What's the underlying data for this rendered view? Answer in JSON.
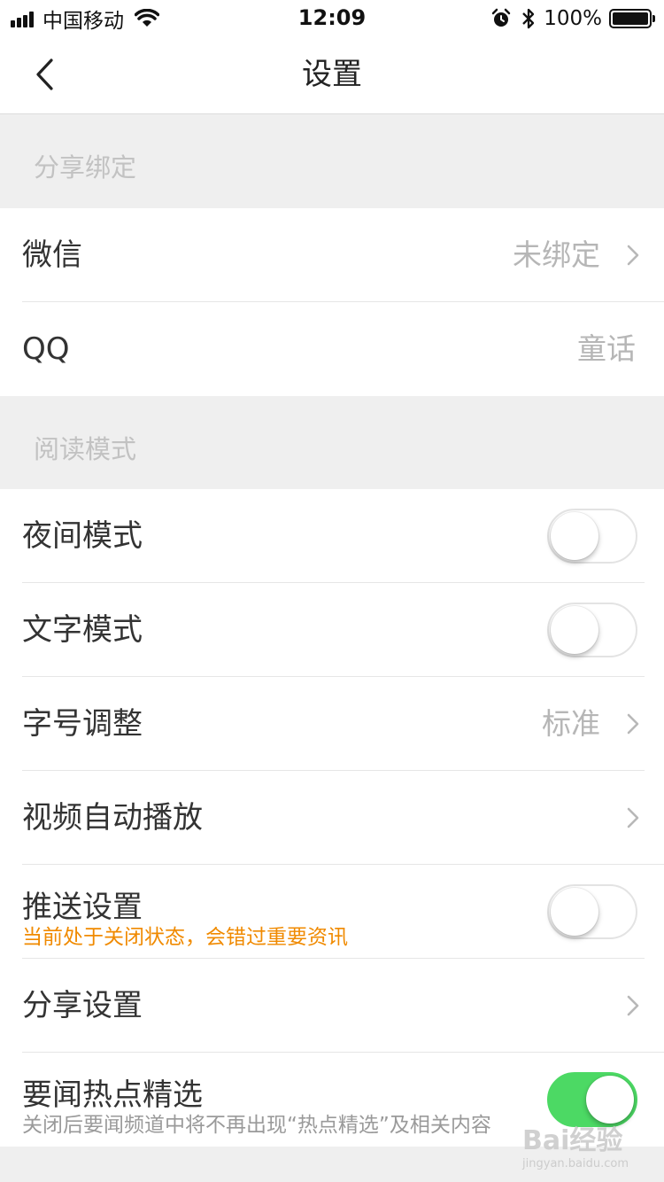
{
  "status_bar": {
    "carrier": "中国移动",
    "time": "12:09",
    "battery_pct": "100%",
    "icons": [
      "signal-icon",
      "wifi-icon",
      "alarm-icon",
      "bluetooth-icon",
      "battery-icon"
    ]
  },
  "nav": {
    "title": "设置",
    "back_icon": "chevron-left-icon"
  },
  "sections": {
    "share_binding": "分享绑定",
    "reading_mode": "阅读模式"
  },
  "rows": {
    "wechat": {
      "label": "微信",
      "value": "未绑定"
    },
    "qq": {
      "label": "QQ",
      "value": "童话"
    },
    "night_mode": {
      "label": "夜间模式",
      "toggle": false
    },
    "text_mode": {
      "label": "文字模式",
      "toggle": false
    },
    "font_size": {
      "label": "字号调整",
      "value": "标准"
    },
    "video_autoplay": {
      "label": "视频自动播放"
    },
    "push": {
      "label": "推送设置",
      "subtitle": "当前处于关闭状态，会错过重要资讯",
      "toggle": false
    },
    "share_settings": {
      "label": "分享设置"
    },
    "hot_picks": {
      "label": "要闻热点精选",
      "subtitle": "关闭后要闻频道中将不再出现“热点精选”及相关内容",
      "toggle": true
    }
  },
  "watermark": {
    "brand": "Bai经验",
    "url": "jingyan.baidu.com"
  },
  "colors": {
    "accent_orange": "#f08a00",
    "toggle_on": "#4cd964",
    "section_bg": "#efefef",
    "muted_text": "#b6b6b6"
  }
}
